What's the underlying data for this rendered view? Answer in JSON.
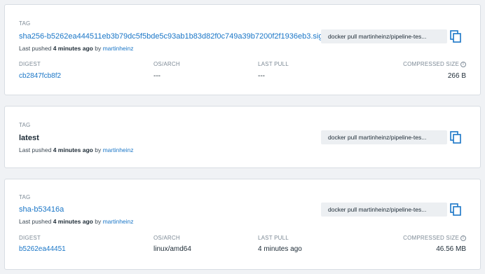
{
  "labels": {
    "tag": "TAG",
    "digest": "DIGEST",
    "os_arch": "OS/ARCH",
    "last_pull": "LAST PULL",
    "compressed_size": "COMPRESSED SIZE",
    "info_glyph": "i",
    "pushed_prefix": "Last pushed",
    "pushed_by": "by"
  },
  "tags": [
    {
      "name": "sha256-b5262ea444511eb3b79dc5f5bde5c93ab1b83d82f0c749a39b7200f2f1936eb3.sig",
      "pushed_ago": "4 minutes ago",
      "pushed_by_user": "martinheinz",
      "pull_command": "docker pull martinheinz/pipeline-tes...",
      "digest": "cb2847fcb8f2",
      "os_arch": "---",
      "last_pull": "---",
      "compressed_size": "266 B"
    },
    {
      "name": "latest",
      "pushed_ago": "4 minutes ago",
      "pushed_by_user": "martinheinz",
      "pull_command": "docker pull martinheinz/pipeline-tes..."
    },
    {
      "name": "sha-b53416a",
      "pushed_ago": "4 minutes ago",
      "pushed_by_user": "martinheinz",
      "pull_command": "docker pull martinheinz/pipeline-tes...",
      "digest": "b5262ea44451",
      "os_arch": "linux/amd64",
      "last_pull": "4 minutes ago",
      "compressed_size": "46.56 MB"
    }
  ],
  "icons": {
    "copy": "copy-icon",
    "info": "info-icon"
  },
  "colors": {
    "link": "#1a76c7",
    "copy_icon": "#1a76c7",
    "background": "#f0f2f5"
  }
}
